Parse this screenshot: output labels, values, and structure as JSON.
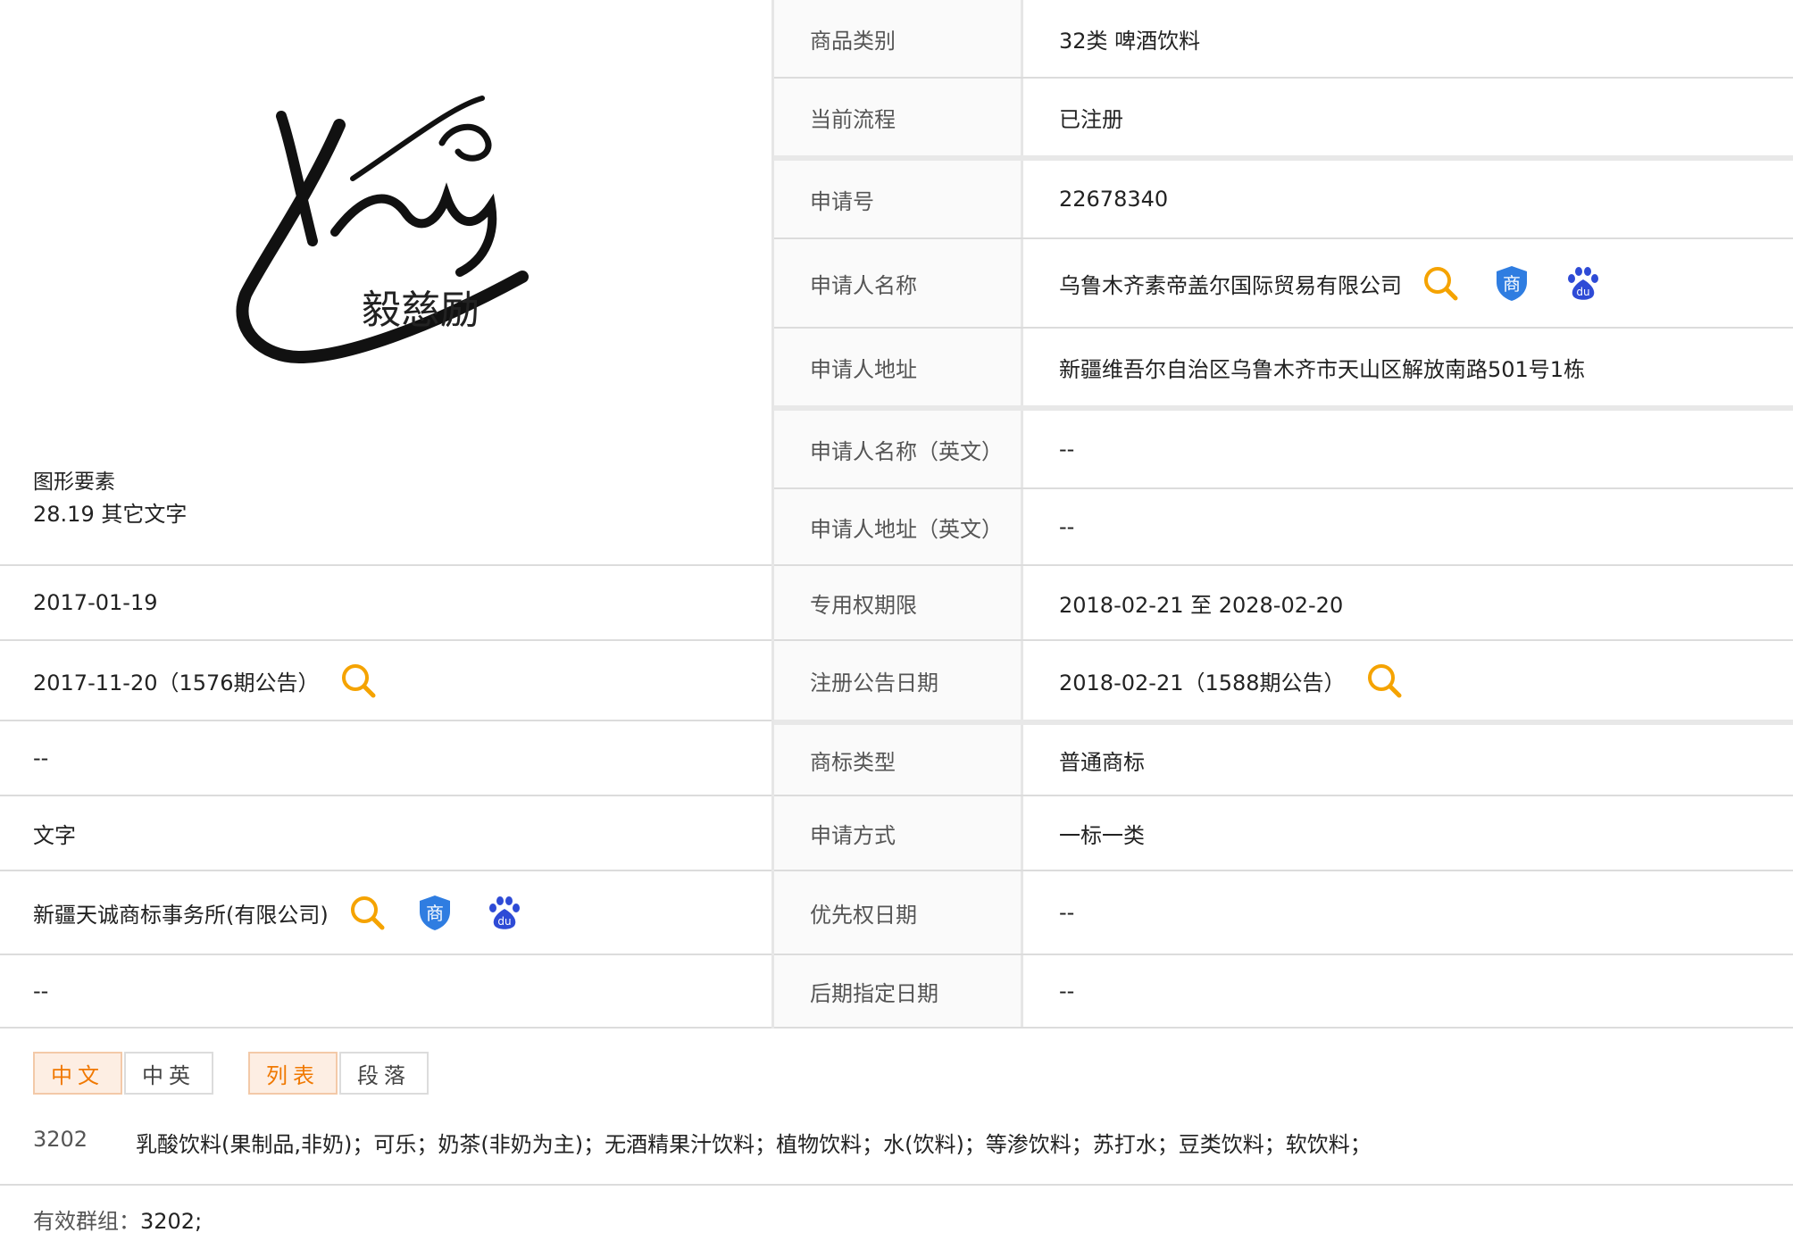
{
  "colors": {
    "accent_orange": "#f07800",
    "shield_blue": "#2f7de1",
    "baidu_blue": "#2e4bd6",
    "border": "#dcdcdc",
    "label_bg": "#fafafa"
  },
  "logo": {
    "script_glyphs": "مۇسكل",
    "chinese_text": "毅慈励"
  },
  "figure": {
    "label": "图形要素",
    "value": "28.19 其它文字"
  },
  "left_rows": [
    {
      "value": "2017-01-19"
    },
    {
      "value": "2017-11-20（1576期公告）",
      "icon": "search-icon"
    },
    {
      "value": "--"
    },
    {
      "value": "文字"
    },
    {
      "value": "新疆天诚商标事务所(有限公司)",
      "icons": [
        "search-icon",
        "shield-icon",
        "baidu-icon"
      ]
    },
    {
      "value": "--"
    }
  ],
  "right_rows": [
    {
      "label": "商品类别",
      "value": "32类 啤酒饮料"
    },
    {
      "label": "当前流程",
      "value": "已注册"
    },
    {
      "label": "申请号",
      "value": "22678340"
    },
    {
      "label": "申请人名称",
      "value": "乌鲁木齐素帝盖尔国际贸易有限公司",
      "icons": [
        "search-icon",
        "shield-icon",
        "baidu-icon"
      ]
    },
    {
      "label": "申请人地址",
      "value": "新疆维吾尔自治区乌鲁木齐市天山区解放南路501号1栋"
    },
    {
      "label": "申请人名称（英文）",
      "value": "--"
    },
    {
      "label": "申请人地址（英文）",
      "value": "--"
    },
    {
      "label": "专用权期限",
      "value": "2018-02-21 至 2028-02-20"
    },
    {
      "label": "注册公告日期",
      "value": "2018-02-21（1588期公告）",
      "icon": "search-icon"
    },
    {
      "label": "商标类型",
      "value": "普通商标"
    },
    {
      "label": "申请方式",
      "value": "一标一类"
    },
    {
      "label": "优先权日期",
      "value": "--"
    },
    {
      "label": "后期指定日期",
      "value": "--"
    }
  ],
  "icon_glyphs": {
    "shield_char": "商",
    "baidu_text": "du"
  },
  "tabs": {
    "lang": [
      {
        "label": "中文"
      },
      {
        "label": "中英"
      }
    ],
    "view": [
      {
        "label": "列表"
      },
      {
        "label": "段落"
      }
    ]
  },
  "goods": {
    "code": "3202",
    "items": "乳酸饮料(果制品,非奶)；可乐；奶茶(非奶为主)；无酒精果汁饮料；植物饮料；水(饮料)；等渗饮料；苏打水；豆类饮料；软饮料；"
  },
  "group": {
    "label": "有效群组：",
    "value": "3202;"
  }
}
